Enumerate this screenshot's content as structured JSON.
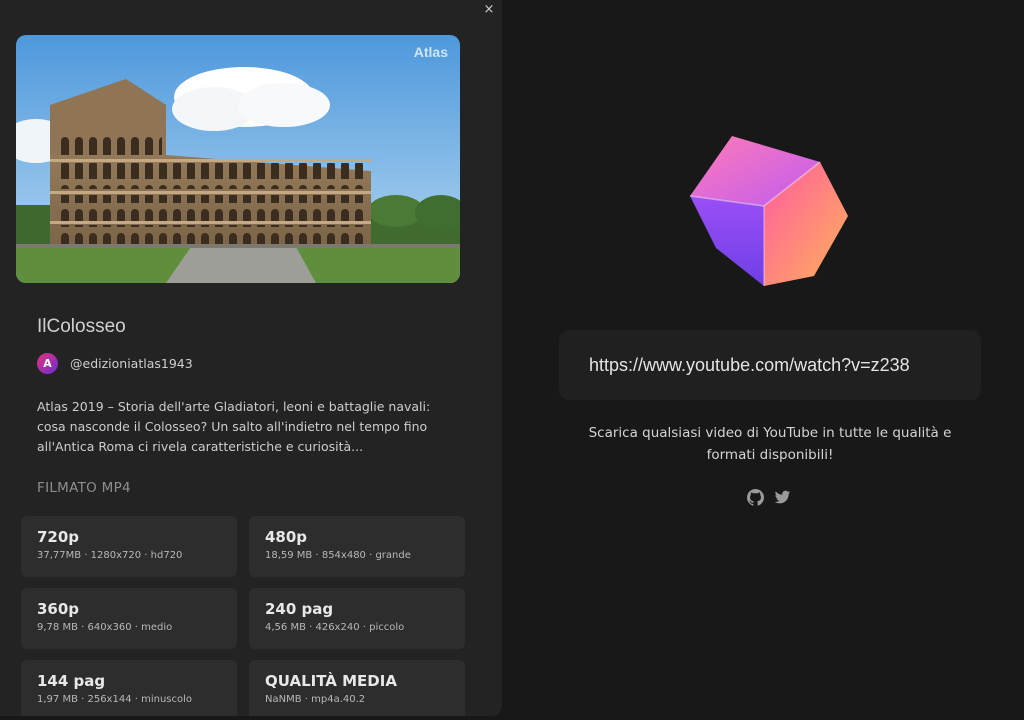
{
  "video": {
    "close_label": "×",
    "thumbnail_watermark": "Atlas",
    "title": "IlColosseo",
    "channel": "@edizioniatlas1943",
    "avatar_letter": "A",
    "description": "Atlas 2019 – Storia dell'arte Gladiatori, leoni e battaglie navali: cosa nasconde il Colosseo? Un salto all'indietro nel tempo fino all'Antica Roma ci rivela caratteristiche e curiosità..."
  },
  "formats": {
    "section_label": "FILMATO MP4",
    "items": [
      {
        "label": "720p",
        "meta": "37,77MB · 1280x720 · hd720"
      },
      {
        "label": "480p",
        "meta": "18,59 MB · 854x480 · grande"
      },
      {
        "label": "360p",
        "meta": "9,78 MB · 640x360 · medio"
      },
      {
        "label": "240 pag",
        "meta": "4,56 MB · 426x240 · piccolo"
      },
      {
        "label": "144 pag",
        "meta": "1,97 MB · 256x144 · minuscolo"
      },
      {
        "label": "QUALITÀ MEDIA",
        "meta": "NaNMB · mp4a.40.2"
      }
    ]
  },
  "search": {
    "url_value": "https://www.youtube.com/watch?v=z238"
  },
  "tagline": "Scarica qualsiasi video di YouTube in tutte le qualità e formati disponibili!",
  "icons": {
    "close": "close-icon",
    "github": "github-icon",
    "twitter": "twitter-icon",
    "logo": "cube-logo-icon"
  },
  "colors": {
    "background": "#181818",
    "panel": "#232323",
    "card": "#2d2d2d",
    "input": "#202020",
    "text": "#e6e6e6",
    "muted": "#8e8e8e"
  }
}
